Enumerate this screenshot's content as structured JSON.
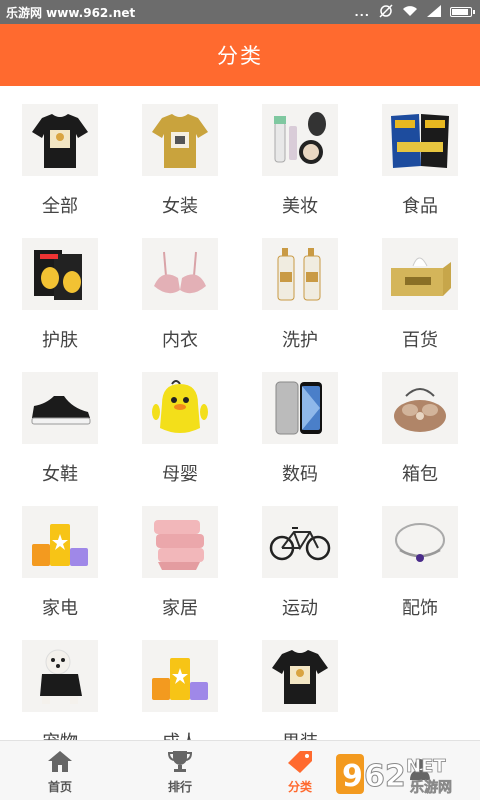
{
  "status_bar": {
    "watermark_text": "乐游网 www.962.net",
    "dots": "...",
    "icons": [
      "alarm-off-icon",
      "wifi-icon",
      "signal-icon",
      "battery-icon"
    ]
  },
  "header": {
    "title": "分类"
  },
  "categories": [
    {
      "label": "全部",
      "icon": "black-tshirt-image"
    },
    {
      "label": "女装",
      "icon": "yellow-tshirt-image"
    },
    {
      "label": "美妆",
      "icon": "cosmetics-image"
    },
    {
      "label": "食品",
      "icon": "chips-image"
    },
    {
      "label": "护肤",
      "icon": "skincare-mask-image"
    },
    {
      "label": "内衣",
      "icon": "bra-image"
    },
    {
      "label": "洗护",
      "icon": "shampoo-bottles-image"
    },
    {
      "label": "百货",
      "icon": "tissue-box-image"
    },
    {
      "label": "女鞋",
      "icon": "sneaker-image"
    },
    {
      "label": "母婴",
      "icon": "duck-bottle-image"
    },
    {
      "label": "数码",
      "icon": "smartphone-image"
    },
    {
      "label": "箱包",
      "icon": "fur-bag-image"
    },
    {
      "label": "家电",
      "icon": "blocks-image"
    },
    {
      "label": "家居",
      "icon": "quilt-image"
    },
    {
      "label": "运动",
      "icon": "bicycle-image"
    },
    {
      "label": "配饰",
      "icon": "bracelet-image"
    },
    {
      "label": "宠物",
      "icon": "dog-image"
    },
    {
      "label": "成人",
      "icon": "blocks-image"
    },
    {
      "label": "男装",
      "icon": "black-tshirt-image"
    }
  ],
  "bottom_nav": {
    "items": [
      {
        "label": "首页",
        "icon": "home-icon",
        "active": false
      },
      {
        "label": "排行",
        "icon": "trophy-icon",
        "active": false
      },
      {
        "label": "分类",
        "icon": "tag-icon",
        "active": true
      },
      {
        "label": "",
        "icon": "person-icon",
        "active": false
      }
    ]
  },
  "watermark": {
    "number": "962",
    "net": "NET",
    "cn": "乐游网"
  },
  "colors": {
    "accent": "#ff6a2f",
    "status_bar": "#6c6c6c",
    "text": "#444444"
  }
}
